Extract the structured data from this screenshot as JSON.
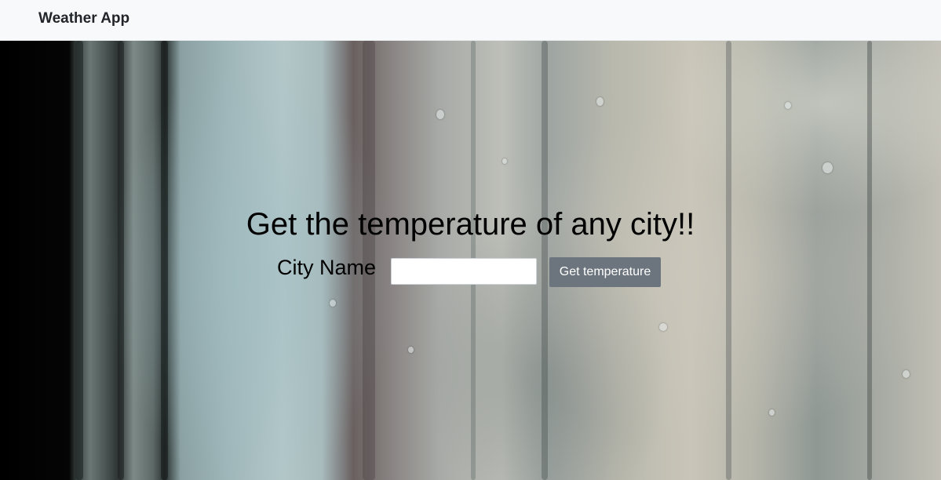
{
  "navbar": {
    "brand": "Weather App"
  },
  "hero": {
    "background": "rain-on-window-photo"
  },
  "main": {
    "heading": "Get the temperature of any city!!",
    "city_label": "City Name",
    "city_input_value": "",
    "button_label": "Get temperature"
  },
  "colors": {
    "navbar_bg": "#f8f9fa",
    "button_bg": "#6c757d",
    "button_text": "#ffffff",
    "heading_text": "#000000"
  }
}
